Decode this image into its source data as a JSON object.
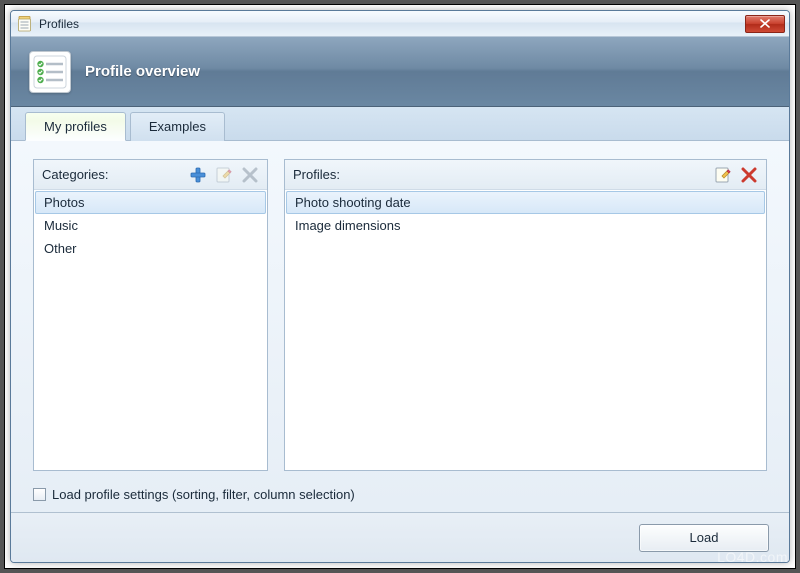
{
  "window": {
    "title": "Profiles"
  },
  "header": {
    "title": "Profile overview"
  },
  "tabs": [
    {
      "label": "My profiles",
      "active": true
    },
    {
      "label": "Examples",
      "active": false
    }
  ],
  "categories_panel": {
    "label": "Categories:",
    "items": [
      "Photos",
      "Music",
      "Other"
    ],
    "selected_index": 0
  },
  "profiles_panel": {
    "label": "Profiles:",
    "items": [
      "Photo shooting date",
      "Image dimensions"
    ],
    "selected_index": 0
  },
  "checkbox": {
    "label": "Load profile settings (sorting, filter, column selection)",
    "checked": false
  },
  "footer": {
    "load_label": "Load"
  },
  "watermark": "LO4D.com"
}
